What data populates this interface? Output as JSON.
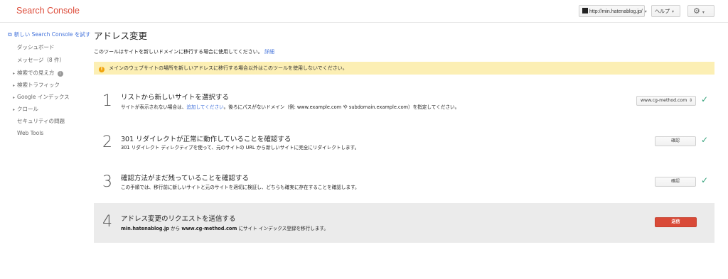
{
  "header": {
    "brand": "Search Console",
    "site_selector": "http://min.hatenablog.jp/",
    "help": "ヘルプ",
    "caret": "▾",
    "gear_icon": "⚙"
  },
  "sidebar": {
    "new_console": "新しい Search Console を試す",
    "items": [
      {
        "label": "ダッシュボード"
      },
      {
        "label": "メッセージ（8 件）"
      },
      {
        "label": "検索での見え方"
      },
      {
        "label": "検索トラフィック"
      },
      {
        "label": "Google インデックス"
      },
      {
        "label": "クロール"
      },
      {
        "label": "セキュリティの問題"
      },
      {
        "label": "Web Tools"
      }
    ]
  },
  "main": {
    "title": "アドレス変更",
    "intro": "このツールはサイトを新しいドメインに移行する場合に使用してください。",
    "intro_link": "詳細",
    "warning": "メインのウェブサイトの場所を新しいアドレスに移行する場合以外はこのツールを使用しないでください。",
    "steps": [
      {
        "num": "1",
        "title": "リストから新しいサイトを選択する",
        "desc_pre": "サイトが表示されない場合は、",
        "desc_link": "追加してください",
        "desc_post": "。後ろにパスがないドメイン（例: www.example.com や subdomain.example.com）を指定してください。",
        "select_value": "www.cg-method.com"
      },
      {
        "num": "2",
        "title": "301 リダイレクトが正常に動作していることを確認する",
        "desc": "301 リダイレクト ディレクティブを使って、元のサイトの URL から新しいサイトに完全にリダイレクトします。",
        "button": "確認"
      },
      {
        "num": "3",
        "title": "確認方法がまだ残っていることを確認する",
        "desc": "この手順では、移行前に新しいサイトと元のサイトを適切に検証し、どちらも確実に存在することを確認します。",
        "button": "確認"
      },
      {
        "num": "4",
        "title": "アドレス変更のリクエストを送信する",
        "desc_old": "min.hatenablog.jp",
        "desc_mid1": " から ",
        "desc_new": "www.cg-method.com",
        "desc_mid2": " にサイト インデックス登録を移行します。",
        "button": "送信"
      }
    ],
    "check_icon": "✓"
  }
}
